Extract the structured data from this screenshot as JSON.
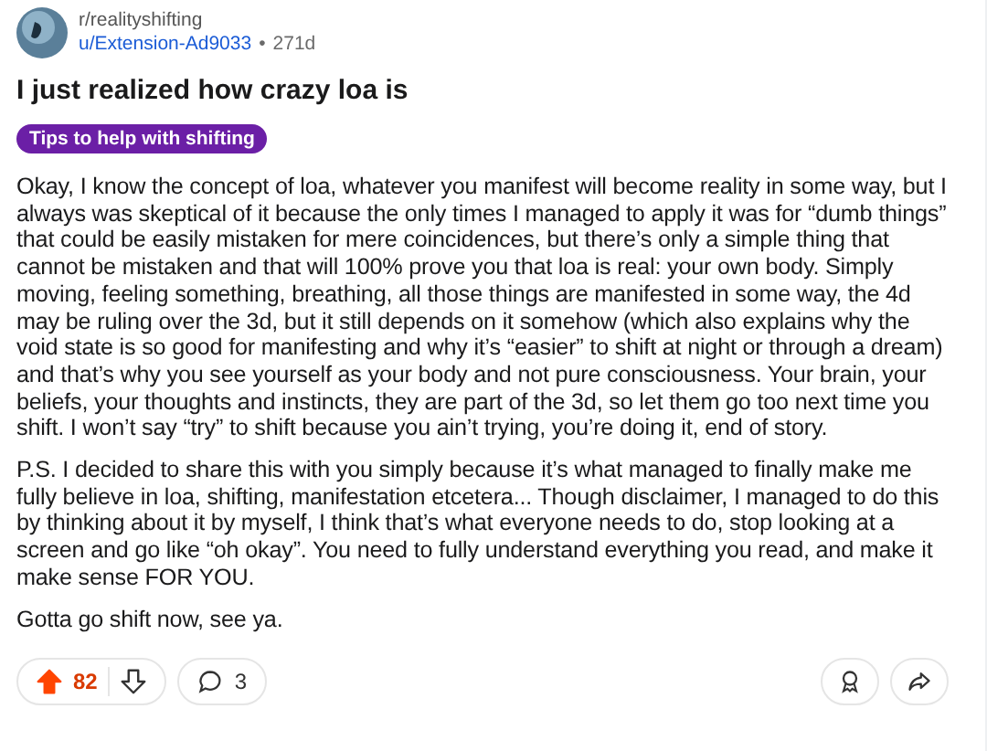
{
  "post": {
    "subreddit": "r/realityshifting",
    "author": "u/Extension-Ad9033",
    "separator": "•",
    "age": "271d",
    "title": "I just realized how crazy loa is",
    "flair": {
      "label": "Tips to help with shifting",
      "color": "#6b1fa6"
    },
    "body": [
      "Okay, I know the concept of loa, whatever you manifest will become reality in some way, but I always was skeptical of it because the only times I managed to apply it was for “dumb things” that could be easily mistaken for mere coincidences, but there’s only a simple thing that cannot be mistaken and that will 100% prove you that loa is real: your own body. Simply moving, feeling something, breathing, all those things are manifested in some way, the 4d may be ruling over the 3d, but it still depends on it somehow (which also explains why the void state is so good for manifesting and why it’s “easier” to shift at night or through a dream) and that’s why you see yourself as your body and not pure consciousness. Your brain, your beliefs, your thoughts and instincts, they are part of the 3d, so let them go too next time you shift. I won’t say “try” to shift because you ain’t trying, you’re doing it, end of story.",
      "P.S. I decided to share this with you simply because it’s what managed to finally make me fully believe in loa, shifting, manifestation etcetera... Though disclaimer, I managed to do this by thinking about it by myself, I think that’s what everyone needs to do, stop looking at a screen and go like “oh okay”. You need to fully understand everything you read, and make it make sense FOR YOU.",
      "Gotta go shift now, see ya."
    ]
  },
  "actions": {
    "upvoted": true,
    "score": "82",
    "comments": "3"
  }
}
